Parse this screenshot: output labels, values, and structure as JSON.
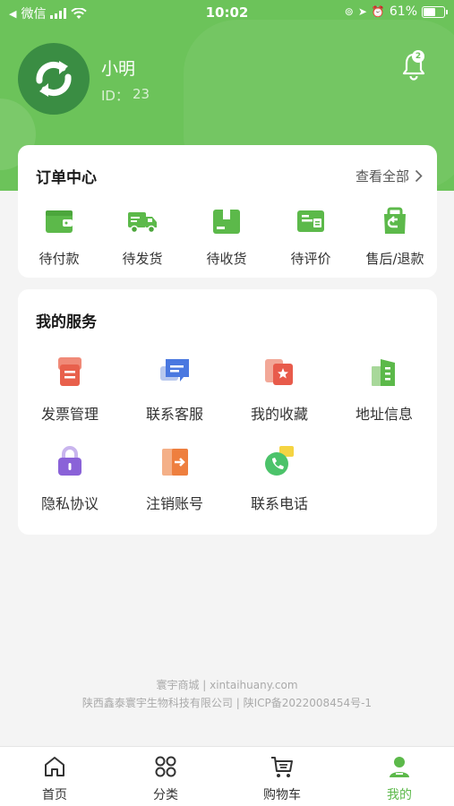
{
  "status_bar": {
    "carrier": "微信",
    "time": "10:02",
    "battery": "61%",
    "battery_level": 0.61
  },
  "profile": {
    "name": "小明",
    "id_label": "ID：",
    "id_value": "23",
    "notification_count": "2"
  },
  "order_center": {
    "title": "订单中心",
    "view_all": "查看全部",
    "items": [
      {
        "label": "待付款",
        "icon": "wallet-icon"
      },
      {
        "label": "待发货",
        "icon": "truck-icon"
      },
      {
        "label": "待收货",
        "icon": "package-icon"
      },
      {
        "label": "待评价",
        "icon": "review-card-icon"
      },
      {
        "label": "售后/退款",
        "icon": "refund-bag-icon"
      }
    ]
  },
  "services": {
    "title": "我的服务",
    "items": [
      {
        "label": "发票管理",
        "icon": "invoice-icon"
      },
      {
        "label": "联系客服",
        "icon": "chat-icon"
      },
      {
        "label": "我的收藏",
        "icon": "favorite-icon"
      },
      {
        "label": "地址信息",
        "icon": "building-icon"
      },
      {
        "label": "隐私协议",
        "icon": "lock-icon"
      },
      {
        "label": "注销账号",
        "icon": "logout-door-icon"
      },
      {
        "label": "联系电话",
        "icon": "phone-icon"
      }
    ]
  },
  "footer": {
    "line1": "寰宇商城 | xintaihuany.com",
    "line2": "陕西鑫泰寰宇生物科技有限公司 | 陕ICP备2022008454号-1"
  },
  "tabbar": {
    "items": [
      {
        "label": "首页",
        "icon": "home-icon"
      },
      {
        "label": "分类",
        "icon": "grid-icon"
      },
      {
        "label": "购物车",
        "icon": "cart-icon"
      },
      {
        "label": "我的",
        "icon": "user-icon",
        "active": true
      }
    ]
  },
  "colors": {
    "brand_green": "#6cc35a",
    "active_tab": "#5cb94a"
  }
}
